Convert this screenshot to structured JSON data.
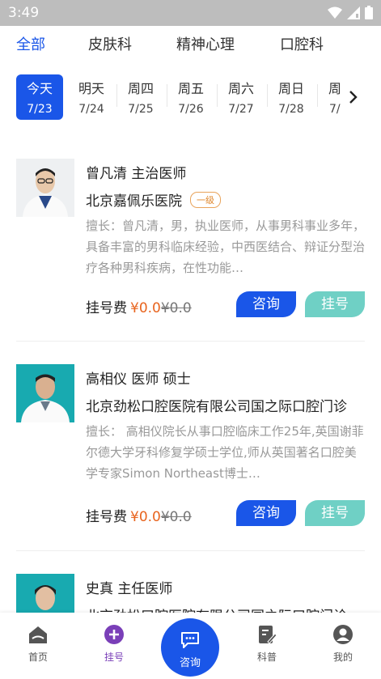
{
  "status_bar": {
    "time": "3:49"
  },
  "dept_tabs": [
    "全部",
    "皮肤科",
    "精神心理",
    "口腔科"
  ],
  "dates": [
    {
      "weekday": "今天",
      "date": "7/23",
      "active": true
    },
    {
      "weekday": "明天",
      "date": "7/24"
    },
    {
      "weekday": "周四",
      "date": "7/25"
    },
    {
      "weekday": "周五",
      "date": "7/26"
    },
    {
      "weekday": "周六",
      "date": "7/27"
    },
    {
      "weekday": "周日",
      "date": "7/28"
    },
    {
      "weekday": "周",
      "date": "7/"
    }
  ],
  "doctors": [
    {
      "name_title": "曾凡清  主治医师",
      "hospital": "北京嘉佩乐医院",
      "level": "一级",
      "desc": "擅长：曾凡清，男，执业医师，从事男科事业多年，具备丰富的男科临床经验，中西医结合、辩证分型治疗各种男科疾病，在性功能…",
      "fee_label": "挂号费",
      "price": "¥0.0",
      "orig_price": "¥0.0",
      "consult_label": "咨询",
      "register_label": "挂号"
    },
    {
      "name_title": "高相仪  医师  硕士",
      "hospital": "北京劲松口腔医院有限公司国之际口腔门诊",
      "desc": "擅长：  高相仪院长从事口腔临床工作25年,英国谢菲尔德大学牙科修复学硕士学位,师从英国著名口腔美学专家Simon Northeast博士…",
      "fee_label": "挂号费",
      "price": "¥0.0",
      "orig_price": "¥0.0",
      "consult_label": "咨询",
      "register_label": "挂号"
    },
    {
      "name_title": "史真  主任医师",
      "hospital": "北京劲松口腔医院有限公司国之际口腔门诊"
    }
  ],
  "bottom_nav": {
    "home": "首页",
    "register": "挂号",
    "consult": "咨询",
    "science": "科普",
    "mine": "我的"
  },
  "colors": {
    "primary": "#1a56e8",
    "register_btn": "#6fd0c5",
    "price": "#e8641e",
    "nav_active": "#7a3fb8"
  },
  "icons": [
    "wifi-icon",
    "signal-icon",
    "battery-icon",
    "chevron-right-icon",
    "home-icon",
    "plus-circle-icon",
    "chat-icon",
    "edit-doc-icon",
    "user-icon"
  ]
}
